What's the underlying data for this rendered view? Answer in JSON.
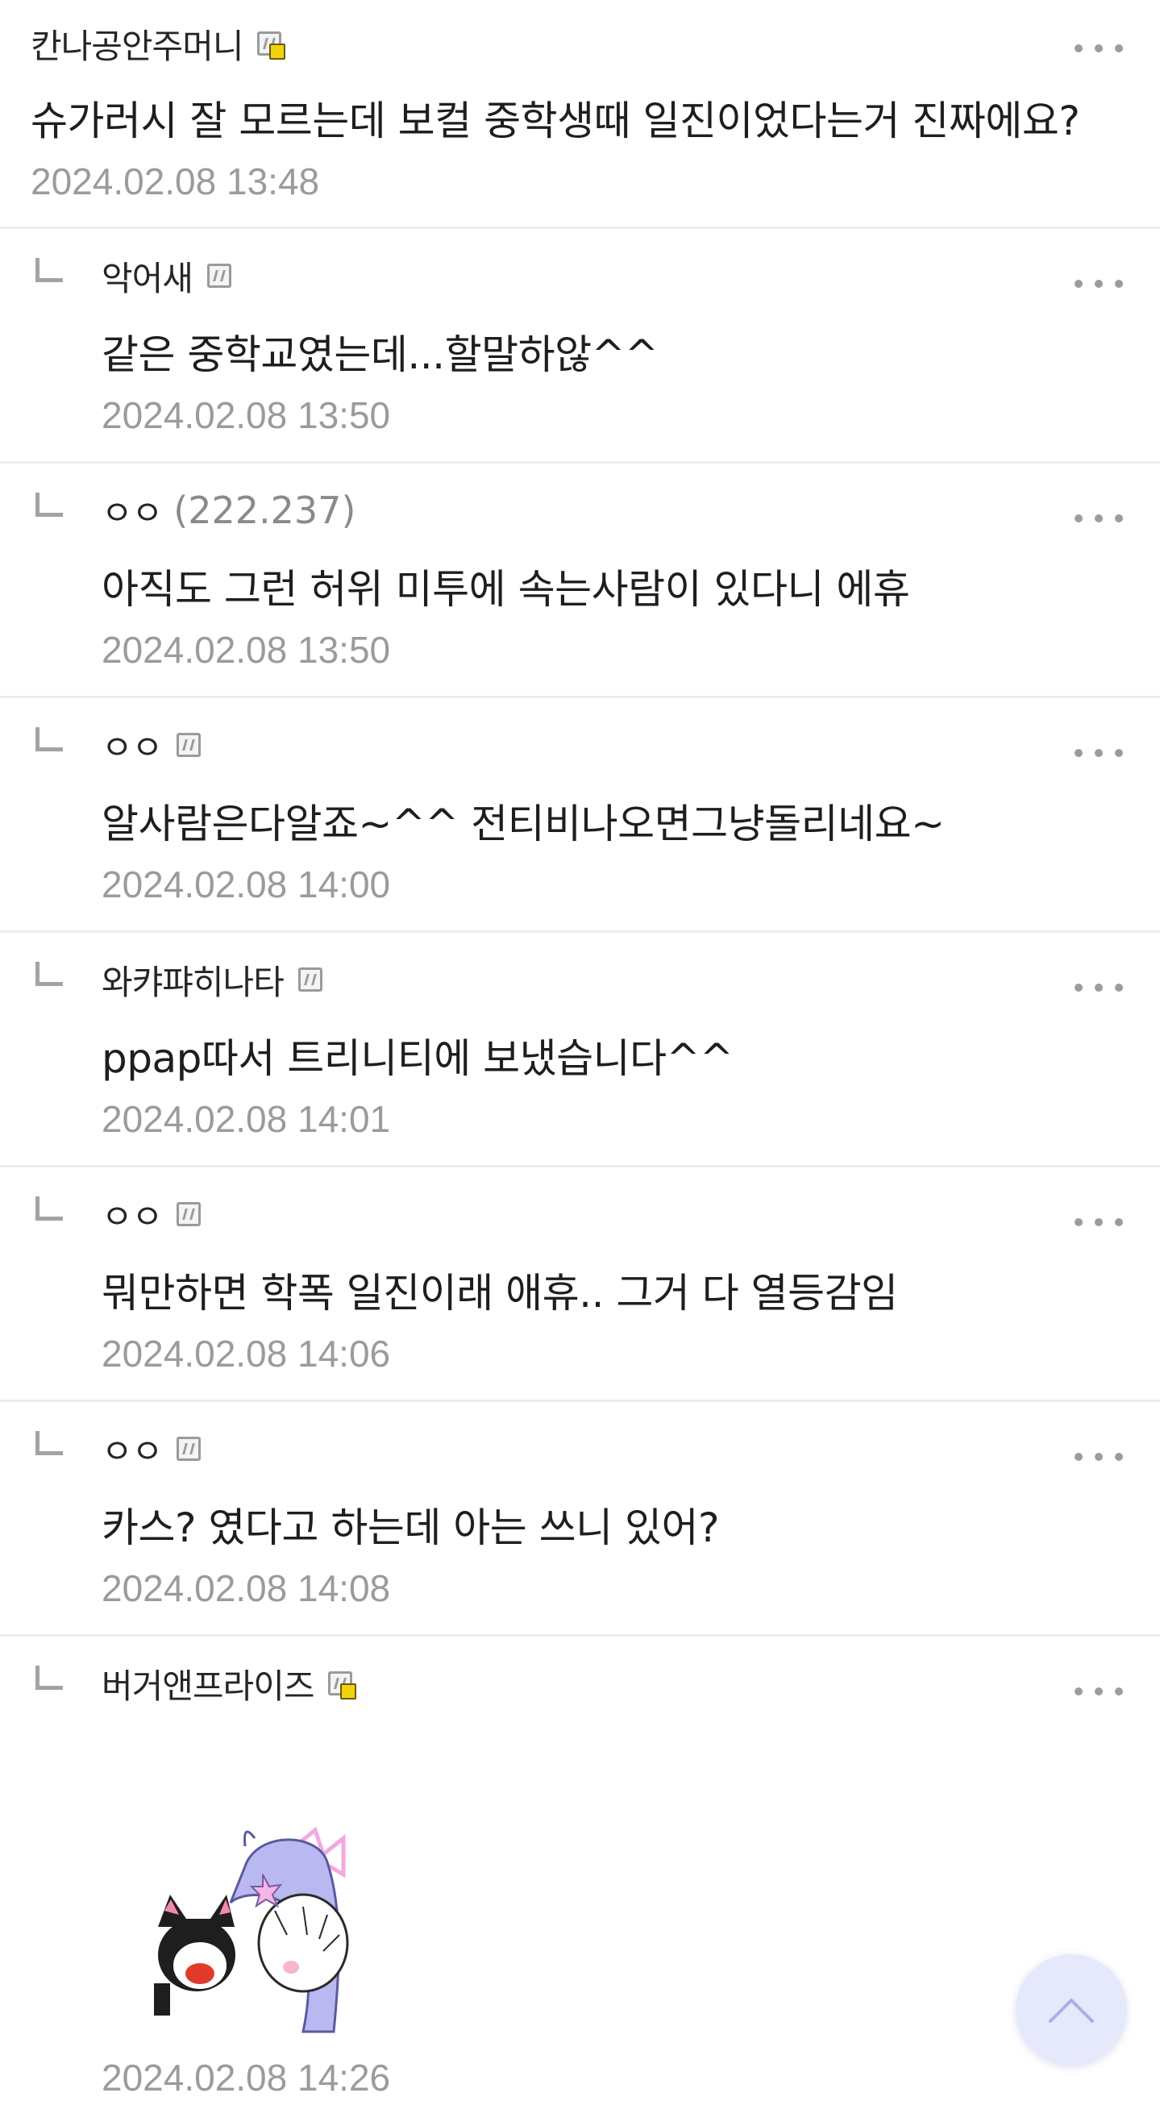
{
  "comments": [
    {
      "nick": "칸나공안주머니",
      "ip": "",
      "badge": "gold",
      "text": "슈가러시 잘 모르는데 보컬 중학생때 일진이었다는거 진짜에요?",
      "date": "2024.02.08 13:48",
      "reply": false
    },
    {
      "nick": "악어새",
      "ip": "",
      "badge": "gray",
      "text": "같은 중학교였는데...할말하않^^",
      "date": "2024.02.08 13:50",
      "reply": true
    },
    {
      "nick": "ㅇㅇ",
      "ip": "(222.237)",
      "badge": "none",
      "text": "아직도 그런 허위 미투에 속는사람이 있다니 에휴",
      "date": "2024.02.08 13:50",
      "reply": true
    },
    {
      "nick": "ㅇㅇ",
      "ip": "",
      "badge": "gray",
      "text": "알사람은다알죠~^^ 전티비나오면그냥돌리네요~",
      "date": "2024.02.08 14:00",
      "reply": true
    },
    {
      "nick": "와캬퍄히나타",
      "ip": "",
      "badge": "gray",
      "text": "ppap따서 트리니티에 보냈습니다^^",
      "date": "2024.02.08 14:01",
      "reply": true
    },
    {
      "nick": "ㅇㅇ",
      "ip": "",
      "badge": "gray",
      "text": "뭐만하면 학폭 일진이래 애휴.. 그거 다 열등감임",
      "date": "2024.02.08 14:06",
      "reply": true
    },
    {
      "nick": "ㅇㅇ",
      "ip": "",
      "badge": "gray",
      "text": "카스? 였다고 하는데 아는 쓰니 있어?",
      "date": "2024.02.08 14:08",
      "reply": true
    },
    {
      "nick": "버거앤프라이즈",
      "ip": "",
      "badge": "gold",
      "text": "",
      "date": "2024.02.08 14:26",
      "reply": true,
      "sticker": "anime-cat-girls-sticker"
    }
  ],
  "icons": {
    "more": "more-dots-icon",
    "reply": "reply-arrow-icon",
    "scroll_top": "chevron-up-icon"
  },
  "colors": {
    "date": "#9b9b9b",
    "divider": "#ececec",
    "scroll_button": "#e6e9fb"
  }
}
